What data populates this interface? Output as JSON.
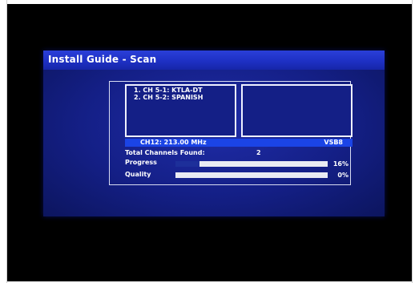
{
  "window": {
    "title": "Install Guide - Scan"
  },
  "scan": {
    "channels": [
      "1. CH 5-1: KTLA-DT",
      "2. CH 5-2: SPANISH"
    ],
    "current_channel": "CH12: 213.00 MHz",
    "modulation": "VSB8",
    "total_label": "Total Channels Found:",
    "total_value": "2",
    "progress": {
      "label": "Progress",
      "text": "16%",
      "value": 0.16
    },
    "quality": {
      "label": "Quality",
      "text": "0%",
      "value": 0.0
    }
  },
  "colors": {
    "screen_background": "#000000",
    "dialog_background": "#141f86",
    "titlebar": "#1e30c4",
    "info_bar": "#1b44e6",
    "bar_track": "#e9ebf3",
    "bar_fill": "#1d2f9a"
  }
}
